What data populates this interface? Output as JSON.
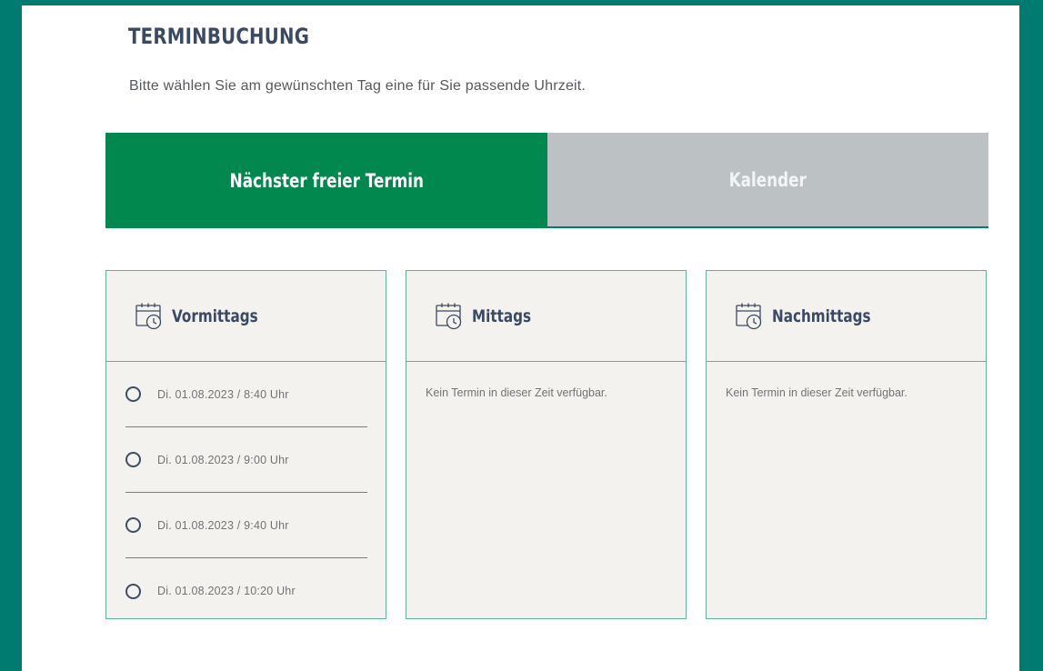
{
  "booking": {
    "title": "TERMINBUCHUNG",
    "intro": "Bitte wählen Sie am gewünschten Tag eine für Sie passende Uhrzeit."
  },
  "tabs": [
    {
      "label": "Nächster freier Termin",
      "active": true
    },
    {
      "label": "Kalender",
      "active": false
    }
  ],
  "colors": {
    "page_background": "#007b70",
    "active_tab": "#00884f",
    "inactive_tab": "#bcc1c4",
    "heading_text": "#3b4a63",
    "card_border": "#5fb39a",
    "card_background": "#f3f2ef"
  },
  "periods": [
    {
      "title": "Vormittags",
      "icon": "calendar-clock-icon",
      "slots": [
        "Di. 01.08.2023 / 8:40 Uhr",
        "Di. 01.08.2023 / 9:00 Uhr",
        "Di. 01.08.2023 / 9:40 Uhr",
        "Di. 01.08.2023 / 10:20 Uhr"
      ]
    },
    {
      "title": "Mittags",
      "icon": "calendar-clock-icon",
      "empty_message": "Kein Termin in dieser Zeit verfügbar."
    },
    {
      "title": "Nachmittags",
      "icon": "calendar-clock-icon",
      "empty_message": "Kein Termin in dieser Zeit verfügbar."
    }
  ]
}
